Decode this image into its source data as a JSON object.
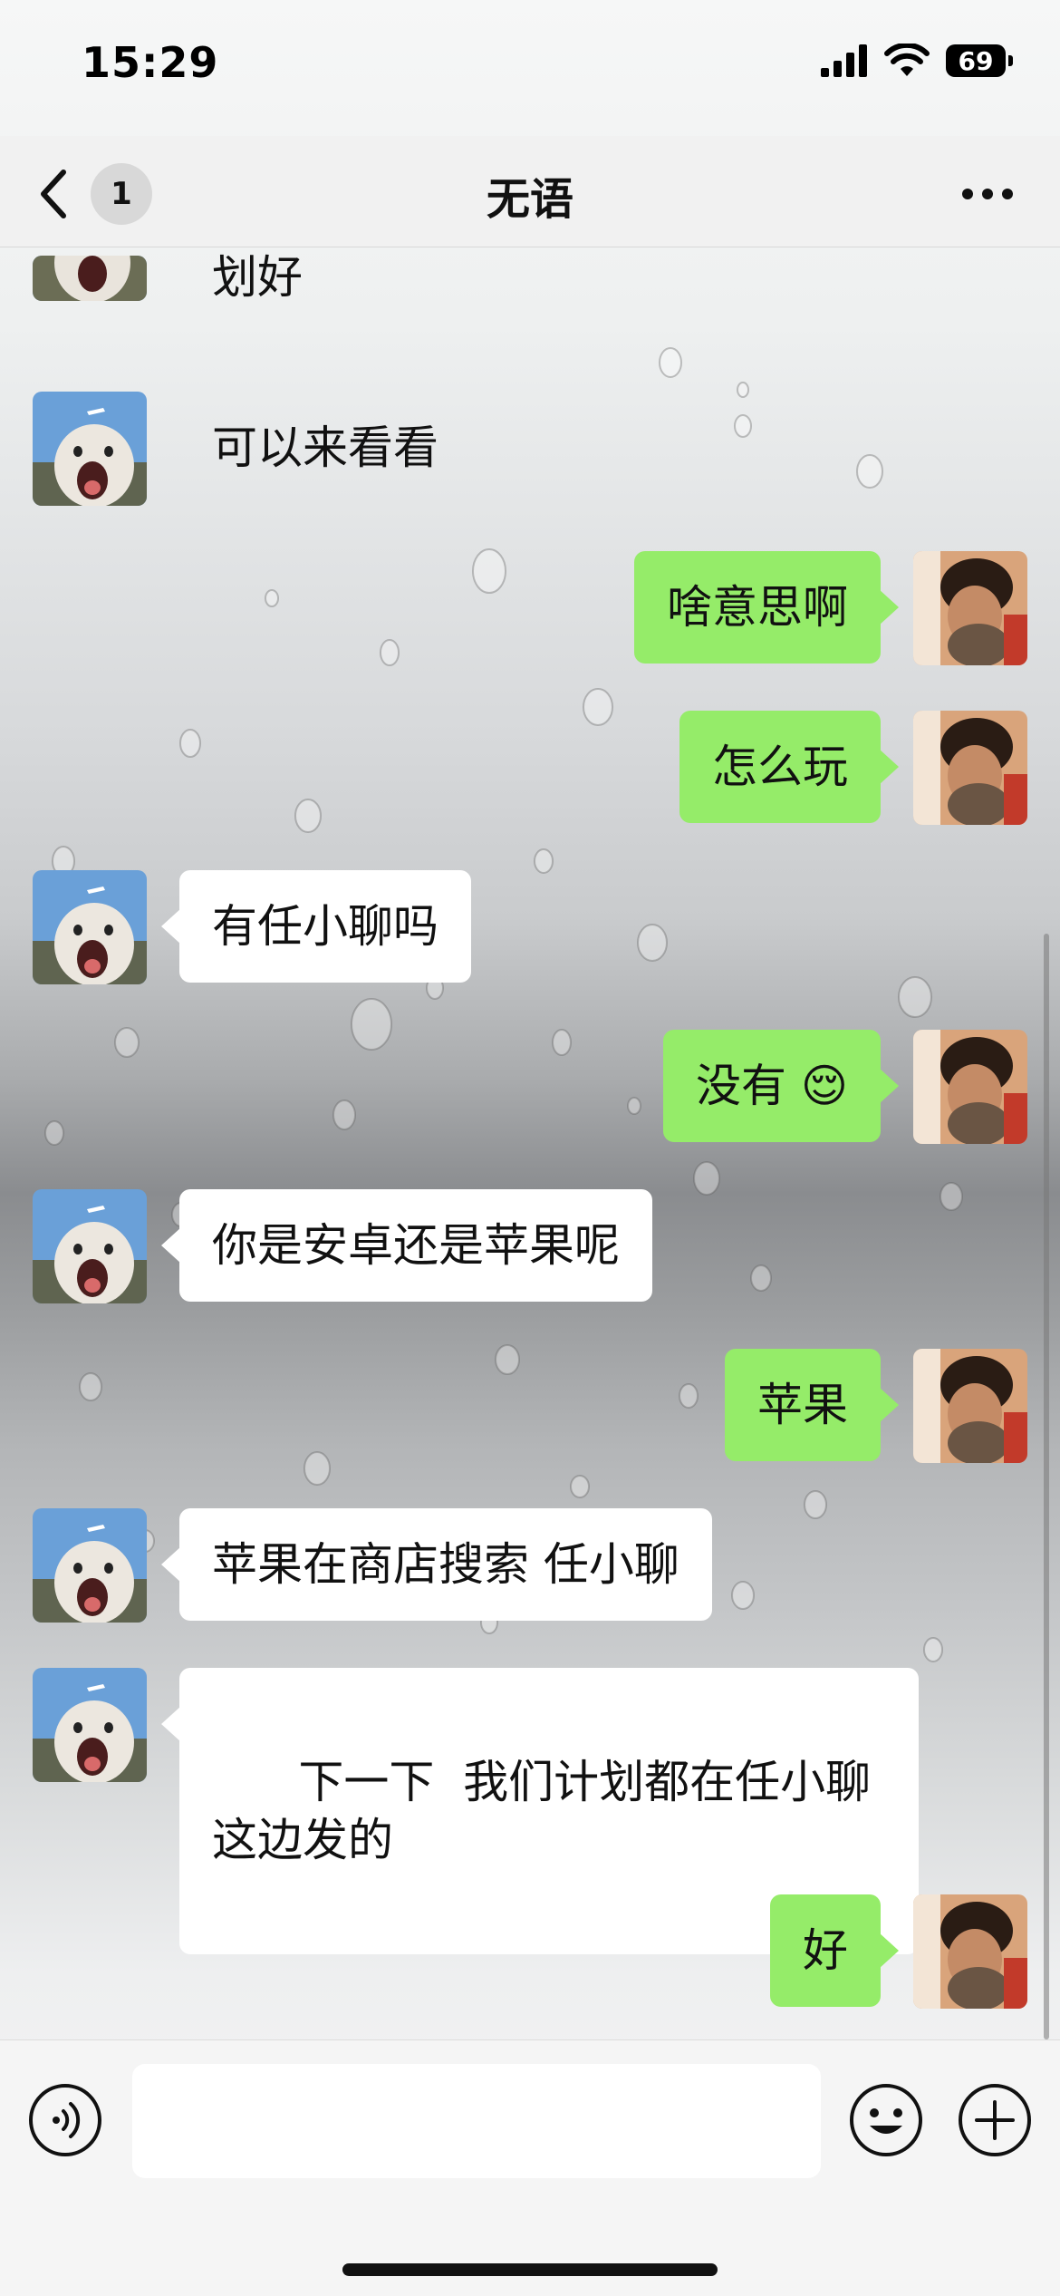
{
  "status_bar": {
    "time": "15:29",
    "battery": "69"
  },
  "nav": {
    "unread_count": "1",
    "title": "无语"
  },
  "messages": [
    {
      "side": "in",
      "text": "划好",
      "partial": true
    },
    {
      "side": "in",
      "text": "可以来看看"
    },
    {
      "side": "out",
      "text": "啥意思啊"
    },
    {
      "side": "out",
      "text": "怎么玩"
    },
    {
      "side": "in",
      "text": "有任小聊吗"
    },
    {
      "side": "out",
      "text": "没有",
      "emoji": "😌"
    },
    {
      "side": "in",
      "text": "你是安卓还是苹果呢"
    },
    {
      "side": "out",
      "text": "苹果"
    },
    {
      "side": "in",
      "text": "苹果在商店搜索 任小聊"
    },
    {
      "side": "in",
      "text": "下一下  我们计划都在任小聊这边发的"
    },
    {
      "side": "out",
      "text": "好"
    }
  ],
  "input": {
    "value": "",
    "placeholder": ""
  },
  "colors": {
    "outgoing_bubble": "#95ec69",
    "incoming_bubble": "#ffffff"
  },
  "icons": [
    "back-chevron-icon",
    "more-icon",
    "voice-icon",
    "emoji-icon",
    "plus-icon"
  ]
}
